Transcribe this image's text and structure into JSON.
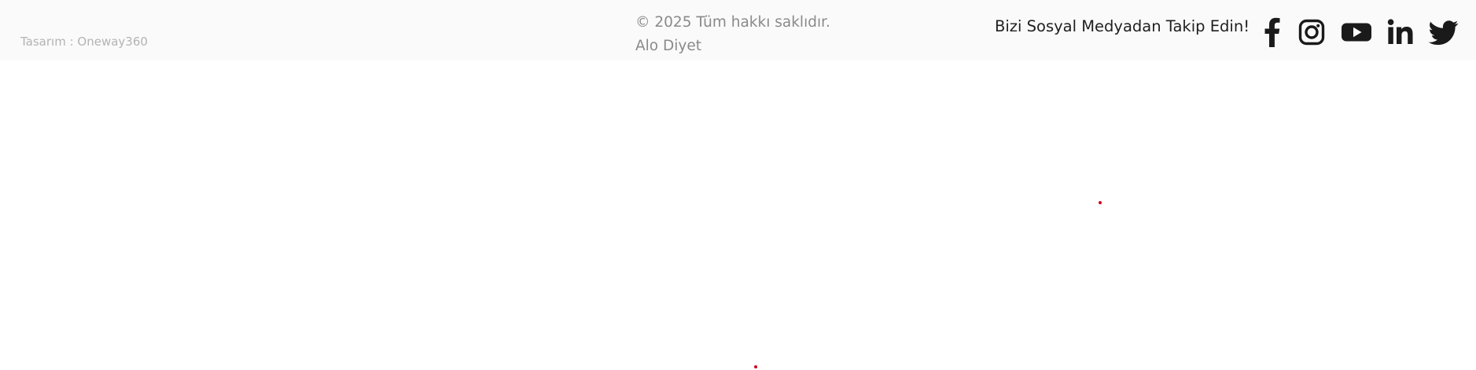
{
  "footer": {
    "designer_credit": "Tasarım : Oneway360",
    "copyright": "© 2025 Tüm hakkı saklıdır. Alo Diyet",
    "follow_label": "Bizi Sosyal Medyadan Takip Edin!",
    "social_links": [
      {
        "name": "facebook",
        "icon": "facebook-icon"
      },
      {
        "name": "instagram",
        "icon": "instagram-icon"
      },
      {
        "name": "youtube",
        "icon": "youtube-icon"
      },
      {
        "name": "linkedin",
        "icon": "linkedin-icon"
      },
      {
        "name": "twitter",
        "icon": "twitter-icon"
      }
    ]
  },
  "colors": {
    "footer_background": "#fafafa",
    "designer_text": "#b3b3b3",
    "copyright_text": "#8a8a8a",
    "follow_text": "#1f1f1f",
    "icon_color": "#1a1a1a",
    "dot_color": "#d0021b"
  }
}
